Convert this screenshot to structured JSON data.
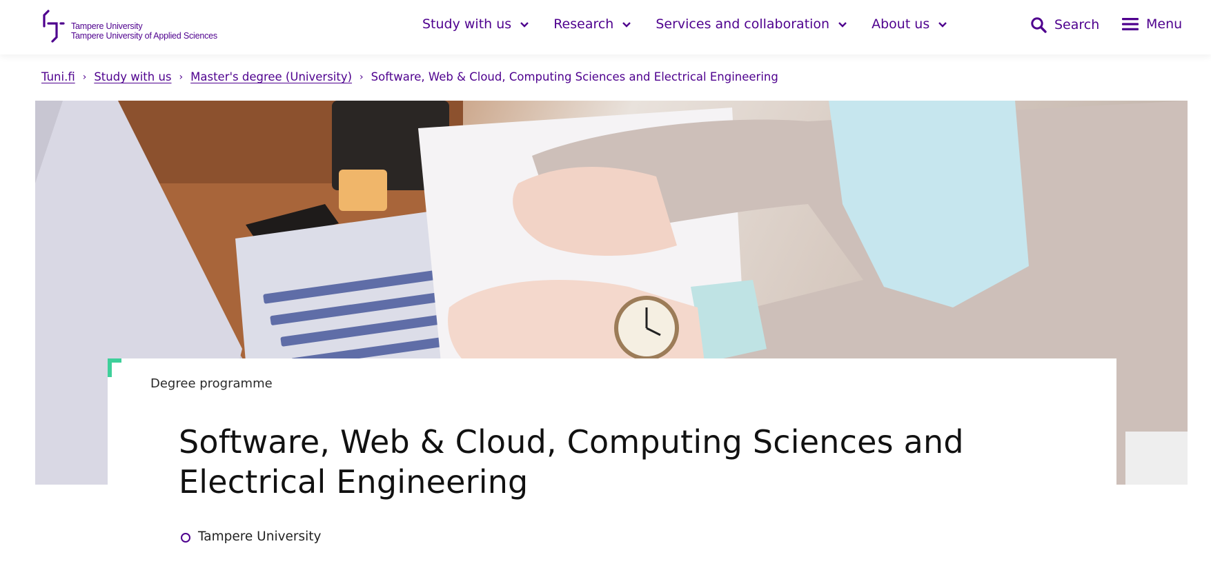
{
  "header": {
    "logo": {
      "line1": "Tampere University",
      "line2": "Tampere University of Applied Sciences",
      "mark_icon": "tuni-bracket-logo"
    },
    "nav": [
      {
        "label": "Study with us"
      },
      {
        "label": "Research"
      },
      {
        "label": "Services and collaboration"
      },
      {
        "label": "About us"
      }
    ],
    "search_label": "Search",
    "menu_label": "Menu"
  },
  "breadcrumb": {
    "items": [
      {
        "label": "Tuni.fi"
      },
      {
        "label": "Study with us"
      },
      {
        "label": "Master's degree (University)"
      }
    ],
    "current": "Software, Web & Cloud, Computing Sciences and Electrical Engineering",
    "separator": "›"
  },
  "hero": {
    "image": "laptop-typing-photo"
  },
  "card": {
    "eyebrow": "Degree programme",
    "title": "Software, Web & Cloud, Computing Sciences and Electrical Engineering",
    "institution": "Tampere University"
  },
  "colors": {
    "brand": "#4e008e",
    "accent": "#3ecf9a",
    "text": "#111111"
  }
}
